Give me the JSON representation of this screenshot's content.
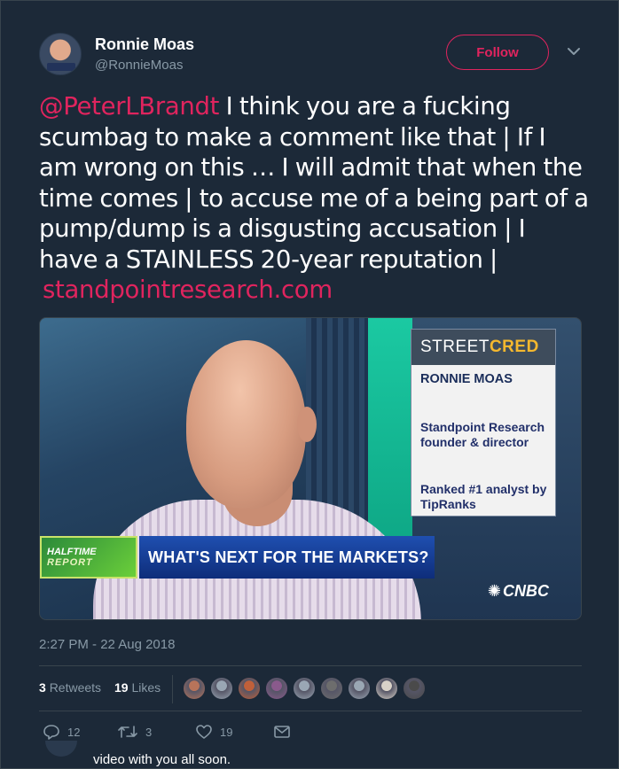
{
  "author": {
    "name": "Ronnie Moas",
    "handle": "@RonnieMoas",
    "follow_label": "Follow"
  },
  "tweet": {
    "mention": "@PeterLBrandt",
    "body": " I think you are a fucking scumbag to make a comment like that | If I am wrong on this … I will admit that when the time comes | to accuse me of a being part of a pump/dump is a disgusting accusation | I have a STAINLESS 20-year reputation |",
    "link": "standpointresearch.com"
  },
  "media": {
    "badge_street": "STREET",
    "badge_cred": "CRED",
    "badge_name": "RONNIE MOAS",
    "badge_title": "Standpoint Research founder & director",
    "badge_rank": "Ranked #1 analyst by TipRanks",
    "show_line1": "HALFTIME",
    "show_line2": "REPORT",
    "headline": "WHAT'S NEXT FOR THE MARKETS?",
    "network": "CNBC"
  },
  "timestamp": "2:27 PM - 22 Aug 2018",
  "stats": {
    "retweets_count": "3",
    "retweets_label": "Retweets",
    "likes_count": "19",
    "likes_label": "Likes"
  },
  "likers_colors": [
    "#b8745a",
    "#9aa7b4",
    "#c0603a",
    "#8a5a8c",
    "#9aa7b4",
    "#6d6d6d",
    "#9aa7b4",
    "#d9d2c8",
    "#4a4a4a"
  ],
  "actions": {
    "replies": "12",
    "retweets": "3",
    "likes": "19"
  },
  "next_tweet": {
    "text": "video with you all soon."
  },
  "colors": {
    "background": "#1c2938",
    "accent": "#e0245e",
    "muted": "#8899a6"
  }
}
